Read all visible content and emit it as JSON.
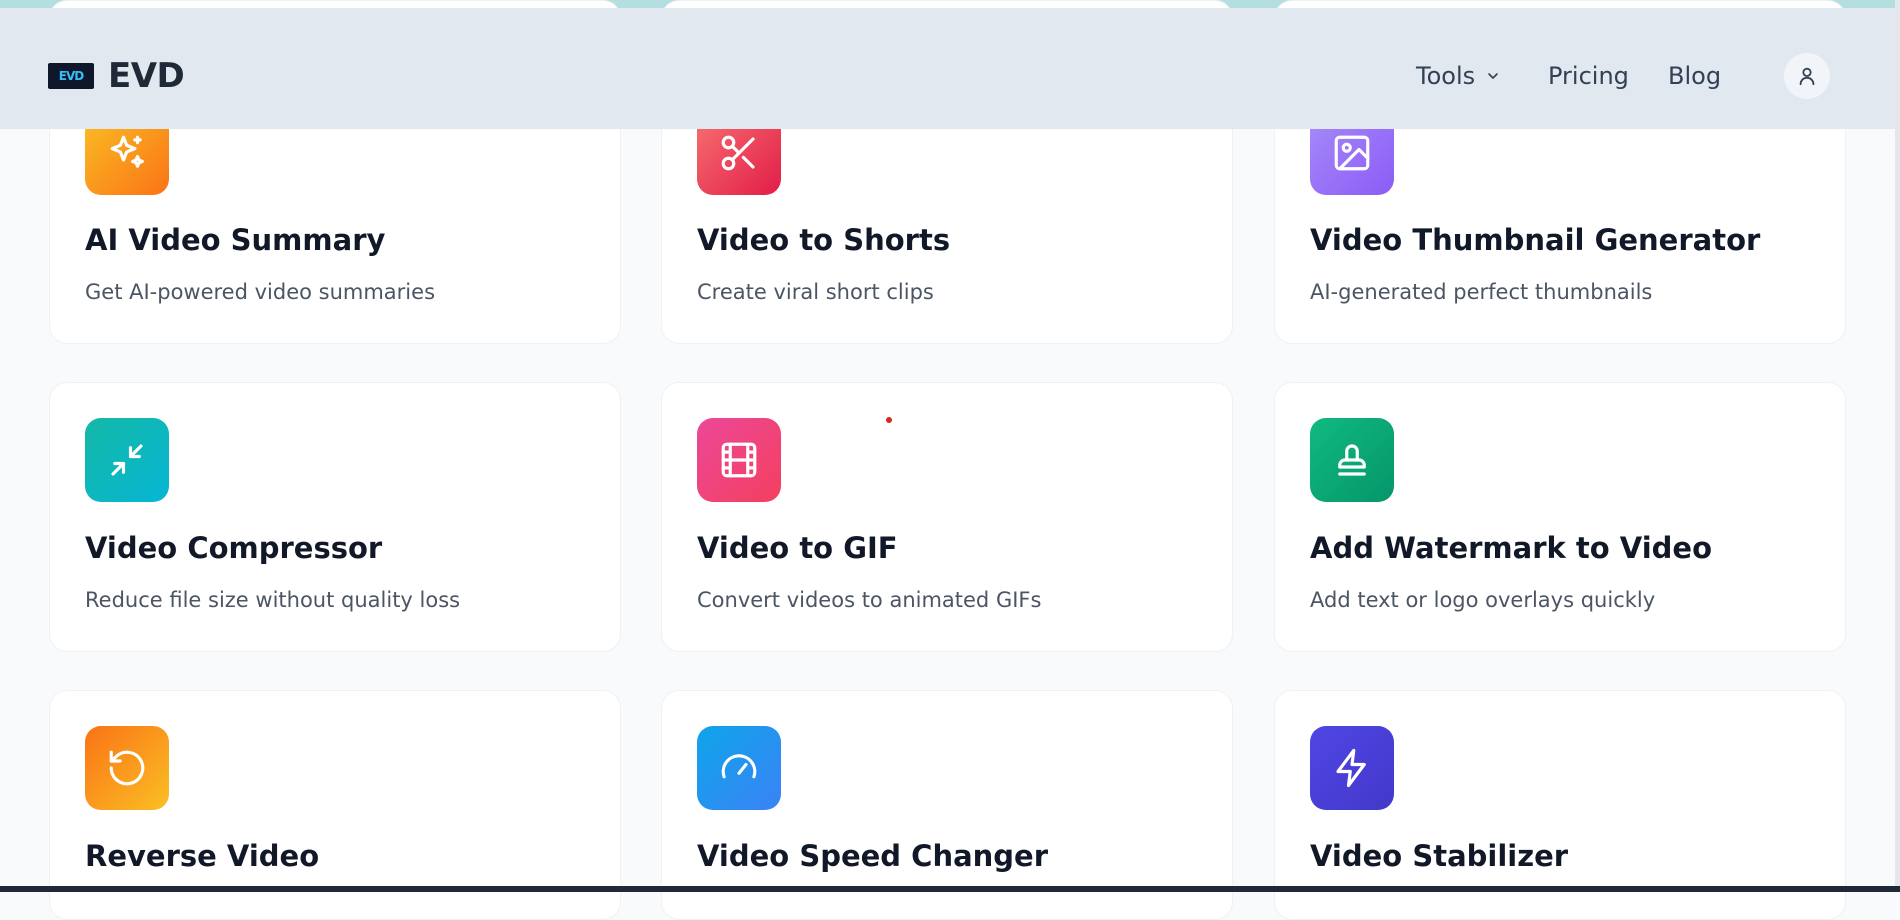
{
  "brand": {
    "logo_label": "EVD",
    "name": "EVD"
  },
  "nav": {
    "tools_label": "Tools",
    "pricing_label": "Pricing",
    "blog_label": "Blog"
  },
  "cards": [
    {
      "title": "AI Video Summary",
      "description": "Get AI-powered video summaries",
      "icon": "sparkles-icon",
      "color": "#f59e0b"
    },
    {
      "title": "Video to Shorts",
      "description": "Create viral short clips",
      "icon": "scissors-icon",
      "color": "#ef4444"
    },
    {
      "title": "Video Thumbnail Generator",
      "description": "AI-generated perfect thumbnails",
      "icon": "image-icon",
      "color": "#8b5cf6"
    },
    {
      "title": "Video Compressor",
      "description": "Reduce file size without quality loss",
      "icon": "minimize-icon",
      "color": "#14b8a6"
    },
    {
      "title": "Video to GIF",
      "description": "Convert videos to animated GIFs",
      "icon": "film-icon",
      "color": "#ec4899"
    },
    {
      "title": "Add Watermark to Video",
      "description": "Add text or logo overlays quickly",
      "icon": "stamp-icon",
      "color": "#10b981"
    },
    {
      "title": "Reverse Video",
      "description": "",
      "icon": "rotate-ccw-icon",
      "color": "#f97316"
    },
    {
      "title": "Video Speed Changer",
      "description": "",
      "icon": "gauge-icon",
      "color": "#3b82f6"
    },
    {
      "title": "Video Stabilizer",
      "description": "",
      "icon": "zap-icon",
      "color": "#4f46e5"
    }
  ]
}
